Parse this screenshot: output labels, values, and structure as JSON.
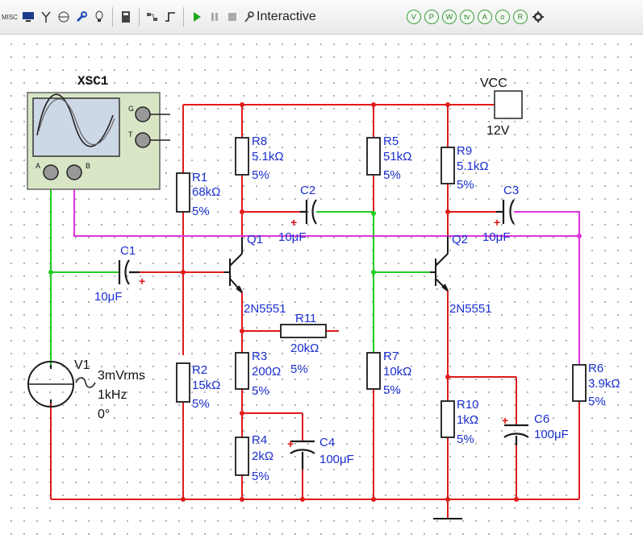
{
  "toolbar": {
    "mode_label": "Interactive",
    "left_icons": [
      "misc-icon",
      "monitor-icon",
      "antenna-icon",
      "probe-icon",
      "wrench-icon",
      "lightbulb-icon",
      "meter-icon",
      "bus-icon",
      "pulse-icon"
    ],
    "probe_icons": [
      "V",
      "P",
      "W",
      "tv",
      "A",
      "o",
      "R"
    ]
  },
  "components": {
    "oscilloscope": {
      "name": "XSC1",
      "pin_g": "G",
      "pin_t": "T",
      "pin_a": "A",
      "pin_b": "B"
    },
    "vcc": {
      "name": "VCC",
      "value": "12V"
    },
    "R1": {
      "name": "R1",
      "value": "68kΩ",
      "tol": "5%"
    },
    "R2": {
      "name": "R2",
      "value": "15kΩ",
      "tol": "5%"
    },
    "R3": {
      "name": "R3",
      "value": "200Ω",
      "tol": "5%"
    },
    "R4": {
      "name": "R4",
      "value": "2kΩ",
      "tol": "5%"
    },
    "R5": {
      "name": "R5",
      "value": "51kΩ",
      "tol": "5%"
    },
    "R6": {
      "name": "R6",
      "value": "3.9kΩ",
      "tol": "5%"
    },
    "R7": {
      "name": "R7",
      "value": "10kΩ",
      "tol": "5%"
    },
    "R8": {
      "name": "R8",
      "value": "5.1kΩ",
      "tol": "5%"
    },
    "R9": {
      "name": "R9",
      "value": "5.1kΩ",
      "tol": "5%"
    },
    "R10": {
      "name": "R10",
      "value": "1kΩ",
      "tol": "5%"
    },
    "R11": {
      "name": "R11",
      "value": "20kΩ",
      "tol": "5%"
    },
    "C1": {
      "name": "C1",
      "value": "10μF",
      "pol": "+"
    },
    "C2": {
      "name": "C2",
      "value": "10μF",
      "pol": "+"
    },
    "C3": {
      "name": "C3",
      "value": "10μF",
      "pol": "+"
    },
    "C4": {
      "name": "C4",
      "value": "100μF",
      "pol": "+"
    },
    "C6": {
      "name": "C6",
      "value": "100μF",
      "pol": "+"
    },
    "Q1": {
      "name": "Q1",
      "model": "2N5551"
    },
    "Q2": {
      "name": "Q2",
      "model": "2N5551"
    },
    "V1": {
      "name": "V1",
      "amp": "3mVrms",
      "freq": "1kHz",
      "phase": "0°"
    }
  },
  "colors": {
    "wire_main": "#e01b1b",
    "wire_input": "#22cc22",
    "wire_output": "#dd33dd",
    "label": "#1a2fd0",
    "component": "#1a1a1a"
  }
}
